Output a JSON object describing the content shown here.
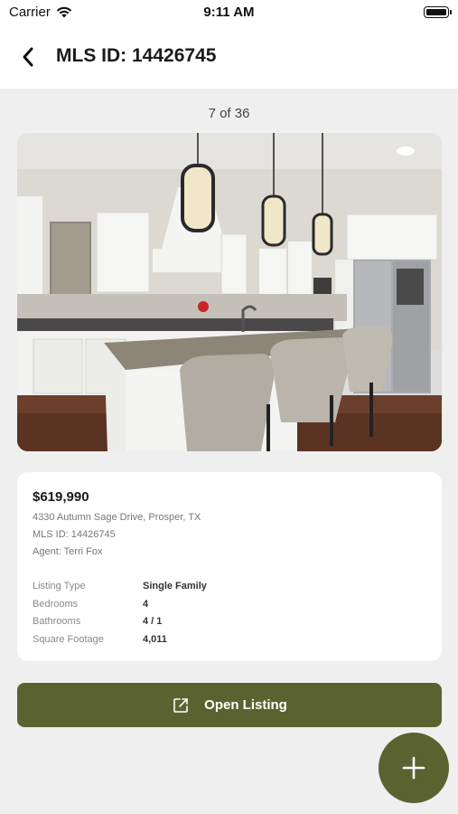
{
  "status": {
    "carrier": "Carrier",
    "time": "9:11 AM"
  },
  "nav": {
    "title": "MLS ID: 14426745"
  },
  "gallery": {
    "counter": "7 of 36"
  },
  "listing": {
    "price": "$619,990",
    "address": "4330 Autumn Sage Drive, Prosper, TX",
    "mls": "MLS ID: 14426745",
    "agent": "Agent: Terri Fox",
    "details": [
      {
        "label": "Listing Type",
        "value": "Single Family"
      },
      {
        "label": "Bedrooms",
        "value": "4"
      },
      {
        "label": "Bathrooms",
        "value": "4 / 1"
      },
      {
        "label": "Square Footage",
        "value": "4,011"
      }
    ]
  },
  "actions": {
    "open_listing": "Open Listing"
  },
  "colors": {
    "accent": "#5a6330",
    "background": "#efefef",
    "card": "#ffffff"
  },
  "icons": {
    "back": "chevron-left-icon",
    "open": "external-link-icon",
    "fab": "plus-icon",
    "wifi": "wifi-icon",
    "battery": "battery-icon"
  }
}
